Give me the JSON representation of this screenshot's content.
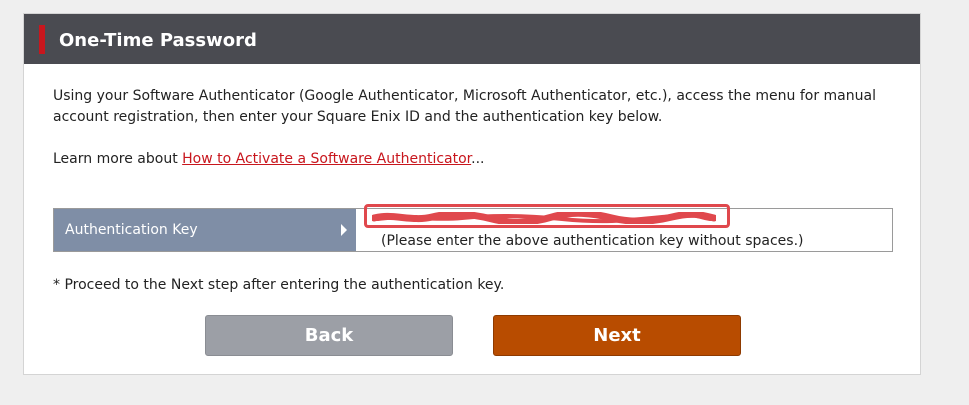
{
  "header": {
    "title": "One-Time Password"
  },
  "intro": {
    "line1": "Using your Software Authenticator (Google Authenticator, Microsoft Authenticator, etc.), access the menu for manual account registration, then enter your Square Enix ID and the authentication key below."
  },
  "learn_more": {
    "prefix": "Learn more about ",
    "link_text": "How to Activate a Software Authenticator",
    "suffix": "..."
  },
  "auth_key": {
    "label": "Authentication Key",
    "note": "(Please enter the above authentication key without spaces.)"
  },
  "proceed_note": "* Proceed to the Next step after entering the authentication key.",
  "buttons": {
    "back": "Back",
    "next": "Next"
  },
  "colors": {
    "header_bg": "#4a4b51",
    "accent": "#c8161d",
    "label_bg": "#7f8ea6",
    "back_button": "#9c9fa6",
    "next_button": "#b84c00",
    "redaction": "#e0484d"
  }
}
